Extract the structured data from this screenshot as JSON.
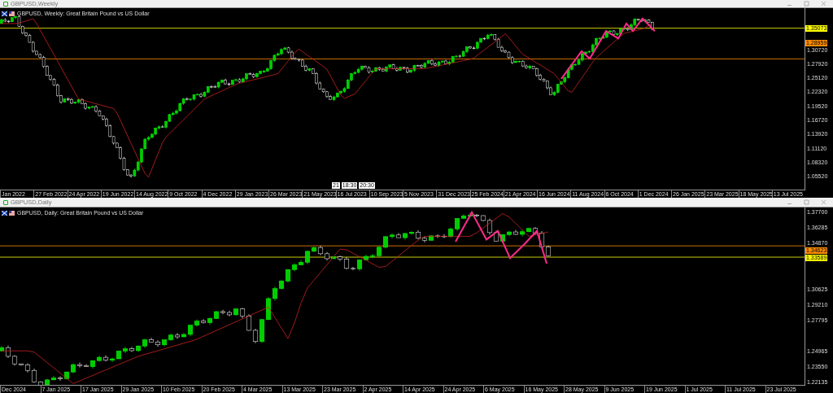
{
  "windows": [
    {
      "title": "GBPUSD,Weekly",
      "chart_header": "GBPUSD, Weekly:  Great Britain Pound vs US Dollar",
      "price_ticks": [
        "1.30720",
        "1.27920",
        "1.25120",
        "1.22320",
        "1.19520",
        "1.16720",
        "1.13920",
        "1.11120",
        "1.08320",
        "1.05520"
      ],
      "price_tags": [
        {
          "text": "1.35073",
          "color": "#ffff00"
        },
        {
          "text": "1.28959",
          "color": "#ff8c00"
        }
      ],
      "time_labels": [
        "Jan 2022",
        "27 Feb 2022",
        "24 Apr 2022",
        "19 Jun 2022",
        "14 Aug 2022",
        "9 Oct 2022",
        "4 Dec 2022",
        "29 Jan 2023",
        "26 Mar 2023",
        "21 May 2023",
        "16 Jul 2023",
        "10 Sep 2023",
        "5 Nov 2023",
        "31 Dec 2023",
        "25 Feb 2024",
        "21 Apr 2024",
        "16 Jun 2024",
        "11 Aug 2024",
        "6 Oct 2024",
        "1 Dec 2024",
        "26 Jan 2025",
        "23 Mar 2025",
        "18 May 2025",
        "13 Jul 2025"
      ],
      "cursor_tags": [
        "21",
        "18:30",
        "20:30"
      ]
    },
    {
      "title": "GBPUSD,Daily",
      "chart_header": "GBPUSD, Daily:  Great Britain Pound vs US Dollar",
      "price_ticks": [
        "1.37700",
        "1.36285",
        "1.34870",
        "1.30625",
        "1.29210",
        "1.27795",
        "1.24965",
        "1.23550",
        "1.22135"
      ],
      "price_tags": [
        {
          "text": "1.34623",
          "color": "#ff8c00"
        },
        {
          "text": "1.33589",
          "color": "#ffff00"
        }
      ],
      "time_labels": [
        "Dec 2024",
        "7 Jan 2025",
        "17 Jan 2025",
        "29 Jan 2025",
        "10 Feb 2025",
        "20 Feb 2025",
        "4 Mar 2025",
        "13 Mar 2025",
        "23 Mar 2025",
        "2 Apr 2025",
        "14 Apr 2025",
        "24 Apr 2025",
        "6 May 2025",
        "16 May 2025",
        "28 May 2025",
        "9 Jun 2025",
        "19 Jun 2025",
        "1 Jul 2025",
        "11 Jul 2025",
        "23 Jul 2025"
      ]
    }
  ]
}
